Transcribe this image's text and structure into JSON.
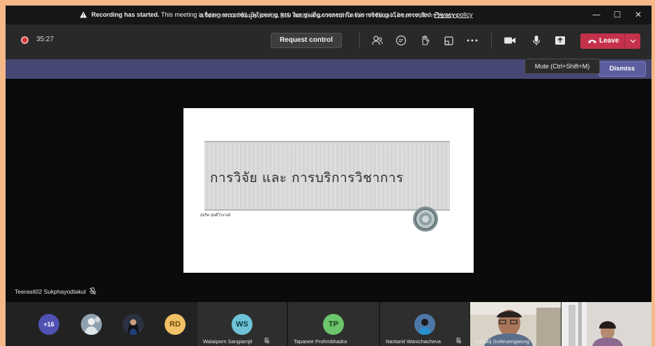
{
  "window": {
    "title": "งเรื่องการกรอกข้อมูลในระบบ RIS ในประเด็นการกรอกโครงการวิจัยและโครงการบริการวิชาการ",
    "controls": [
      "—",
      "☐",
      "✕"
    ]
  },
  "toolbar": {
    "timer": "35:27",
    "request_control_label": "Request control",
    "leave_label": "Leave",
    "icons": [
      "people-icon",
      "chat-icon",
      "raise-hand-icon",
      "share-tray-icon",
      "more-icon",
      "camera-icon",
      "mic-icon",
      "share-icon"
    ],
    "colors": {
      "leave": "#c4314b",
      "banner": "#464775",
      "record": "#d13438"
    }
  },
  "banner": {
    "bold_text": "Recording has started.",
    "text": " This meeting is being recorded. By joining, you are giving consent for this meeting to be recorded. ",
    "link": "Privacy policy",
    "dismiss_label": "Dismiss"
  },
  "tooltip": {
    "text": "Mute (Ctrl+Shift+M)"
  },
  "slide": {
    "title": "การวิจัย และ การบริการวิชาการ",
    "author": "สุจริต สุพดีโรงวงษ์"
  },
  "presenter": {
    "name": "Teerasit02 Sukphayodtakul"
  },
  "participants": {
    "overflow": "+16",
    "initials_rd": "RD",
    "initials_ws": "WS",
    "initials_tp": "TP",
    "name_ws": "Walaiporn Sangiamjit",
    "name_tp": "Tapanee Prohmbhadra",
    "name_nw": "Nantanit Wanichacheva",
    "name_ss": "Supakij Suttiruengwong"
  }
}
